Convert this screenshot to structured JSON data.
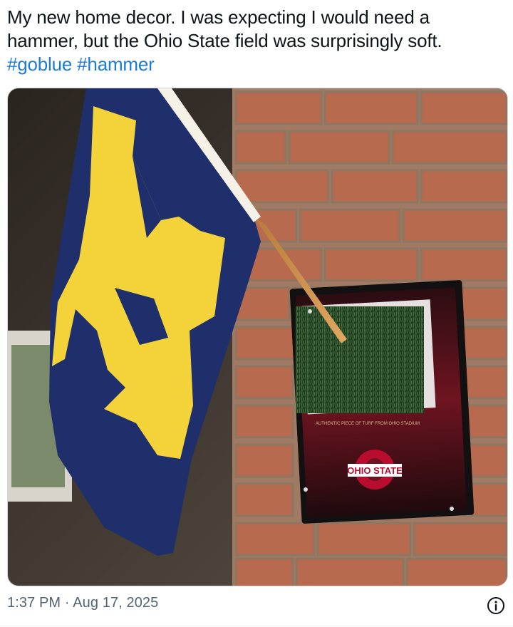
{
  "tweet": {
    "text": "My new home decor. I was expecting I would need a hammer, but the Ohio State field was surprisingly soft.",
    "hashtags": [
      "#goblue",
      "#hammer"
    ],
    "time": "1:37 PM",
    "separator": "·",
    "date": "Aug 17, 2025"
  },
  "media": {
    "flag_letter": "M",
    "plaque_caption": "AUTHENTIC PIECE OF TURF FROM OHIO STADIUM",
    "plaque_logo": "OHIO STATE"
  },
  "icons": {
    "info": "info-circle-icon"
  },
  "colors": {
    "hashtag": "#1d7bd8",
    "meta_text": "#536471",
    "flag_navy": "#1f2f6b",
    "flag_maize": "#f4d33a",
    "plaque_red": "#6e1420",
    "osu_scarlet": "#ba0c2f"
  }
}
